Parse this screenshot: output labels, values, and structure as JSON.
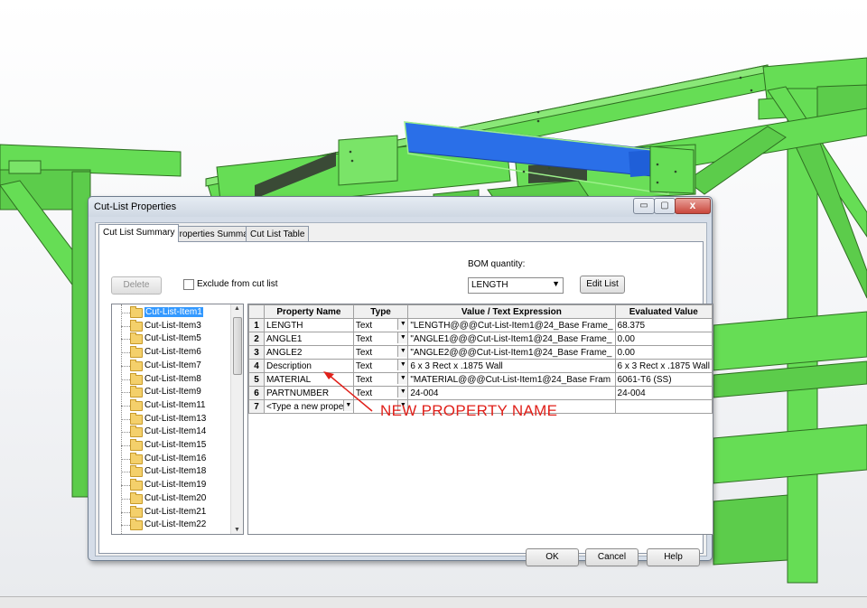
{
  "dialog": {
    "title": "Cut-List Properties",
    "window_buttons": {
      "minimize": "▭",
      "maximize": "▢",
      "close": "x"
    },
    "tabs": [
      {
        "label": "Cut List Summary",
        "active": true
      },
      {
        "label": "Properties Summary",
        "active": false
      },
      {
        "label": "Cut List Table",
        "active": false
      }
    ],
    "delete_label": "Delete",
    "exclude_label": "Exclude from cut list",
    "bom_label": "BOM quantity:",
    "bom_value": "LENGTH",
    "edit_list_label": "Edit List",
    "ok_label": "OK",
    "cancel_label": "Cancel",
    "help_label": "Help"
  },
  "tree": {
    "selected": "Cut-List-Item1",
    "items": [
      "Cut-List-Item1",
      "Cut-List-Item3",
      "Cut-List-Item5",
      "Cut-List-Item6",
      "Cut-List-Item7",
      "Cut-List-Item8",
      "Cut-List-Item9",
      "Cut-List-Item11",
      "Cut-List-Item13",
      "Cut-List-Item14",
      "Cut-List-Item15",
      "Cut-List-Item16",
      "Cut-List-Item18",
      "Cut-List-Item19",
      "Cut-List-Item20",
      "Cut-List-Item21",
      "Cut-List-Item22"
    ]
  },
  "grid": {
    "headers": [
      "Property Name",
      "Type",
      "Value / Text Expression",
      "Evaluated Value"
    ],
    "rows": [
      {
        "n": "1",
        "name": "LENGTH",
        "type": "Text",
        "value": "\"LENGTH@@@Cut-List-Item1@24_Base Frame_",
        "evaluated": "68.375"
      },
      {
        "n": "2",
        "name": "ANGLE1",
        "type": "Text",
        "value": "\"ANGLE1@@@Cut-List-Item1@24_Base Frame_",
        "evaluated": "0.00"
      },
      {
        "n": "3",
        "name": "ANGLE2",
        "type": "Text",
        "value": "\"ANGLE2@@@Cut-List-Item1@24_Base Frame_",
        "evaluated": "0.00"
      },
      {
        "n": "4",
        "name": "Description",
        "type": "Text",
        "value": "6 x 3 Rect x .1875 Wall",
        "evaluated": "6 x 3 Rect x .1875 Wall"
      },
      {
        "n": "5",
        "name": "MATERIAL",
        "type": "Text",
        "value": "\"MATERIAL@@@Cut-List-Item1@24_Base Fram",
        "evaluated": "6061-T6 (SS)"
      },
      {
        "n": "6",
        "name": "PARTNUMBER",
        "type": "Text",
        "value": "24-004",
        "evaluated": "24-004"
      }
    ],
    "new_row": {
      "n": "7",
      "placeholder": "<Type a new propert",
      "type": "",
      "value": "",
      "evaluated": ""
    }
  },
  "annotation": {
    "text": "NEW PROPERTY NAME",
    "color": "#e0201a"
  },
  "colors": {
    "frame_green": "#66dd55",
    "selected_blue": "#2a6fe8",
    "dialog_frame": "#d5dde8"
  }
}
